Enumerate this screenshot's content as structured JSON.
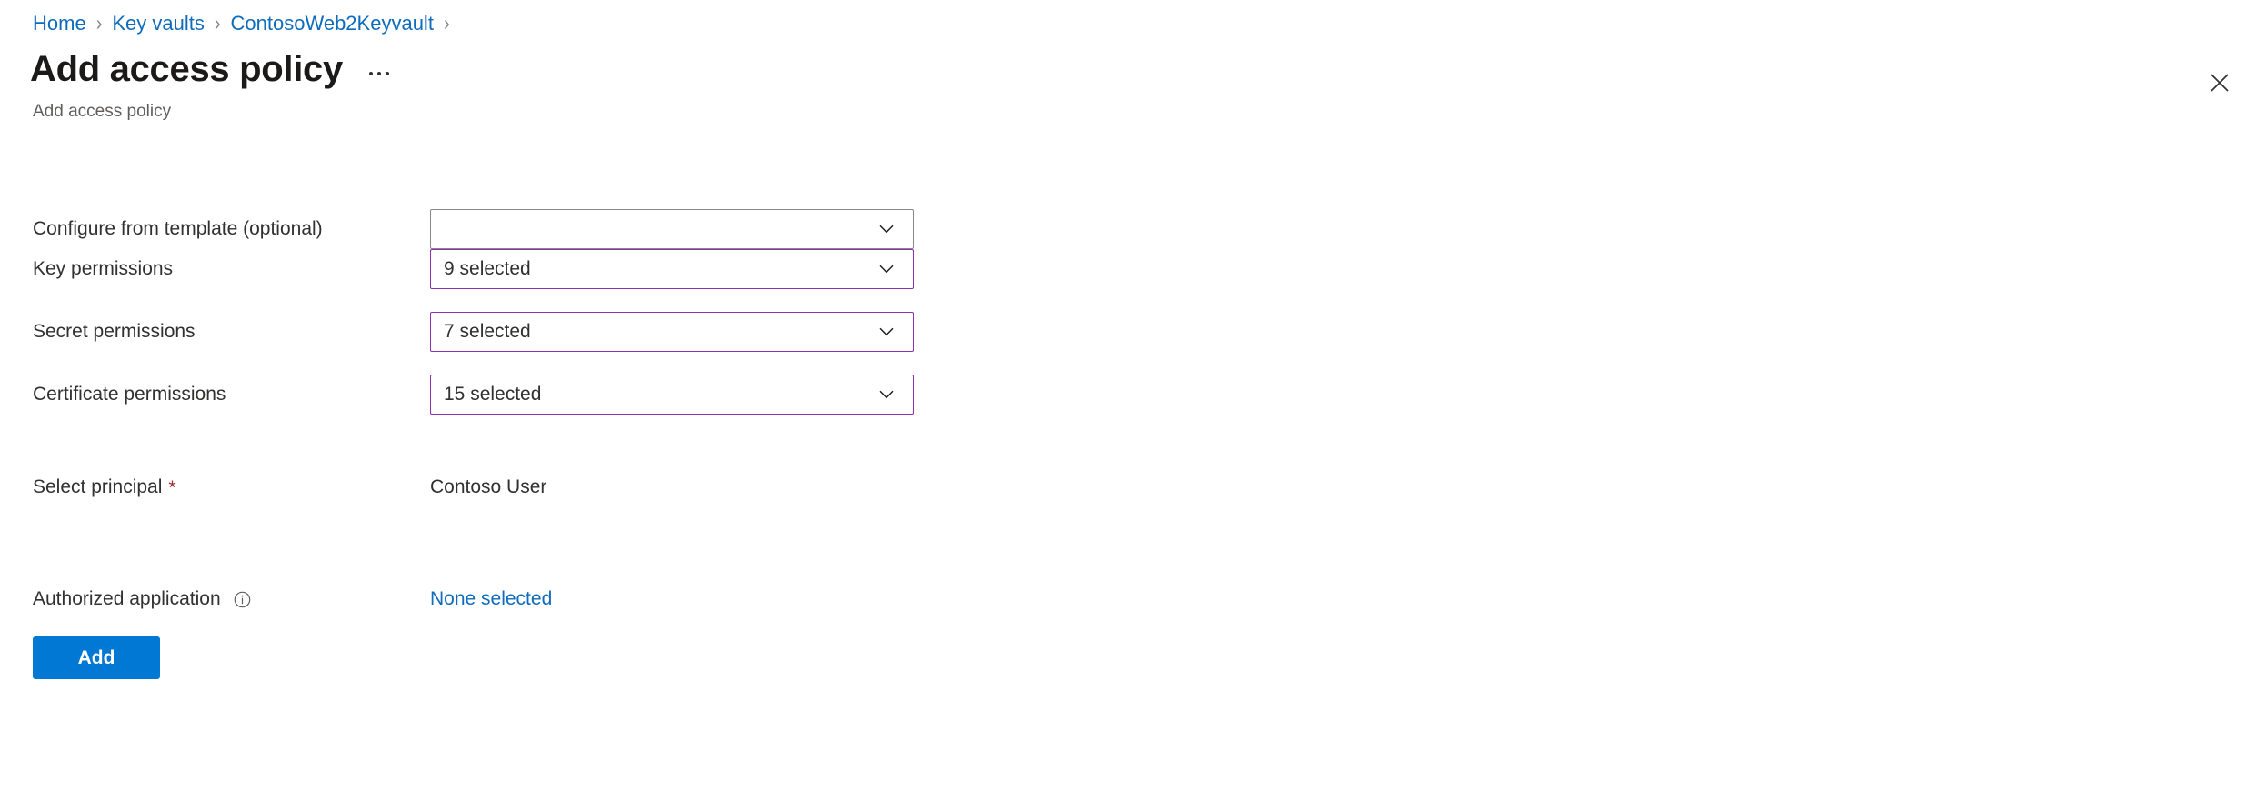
{
  "breadcrumb": {
    "items": [
      {
        "label": "Home"
      },
      {
        "label": "Key vaults"
      },
      {
        "label": "ContosoWeb2Keyvault"
      }
    ],
    "separator": "›"
  },
  "header": {
    "title": "Add access policy",
    "subtitle": "Add access policy",
    "more_actions_label": "More",
    "close_label": "Close"
  },
  "form": {
    "rows": [
      {
        "label": "Configure from template (optional)",
        "control": "dropdown",
        "value": "",
        "placeholder": "",
        "dirty": false,
        "required": false,
        "info": false
      },
      {
        "label": "Key permissions",
        "control": "dropdown",
        "value": "9 selected",
        "placeholder": "",
        "dirty": true,
        "required": false,
        "info": false
      },
      {
        "label": "Secret permissions",
        "control": "dropdown",
        "value": "7 selected",
        "placeholder": "",
        "dirty": true,
        "required": false,
        "info": false
      },
      {
        "label": "Certificate permissions",
        "control": "dropdown",
        "value": "15 selected",
        "placeholder": "",
        "dirty": true,
        "required": false,
        "info": false
      },
      {
        "label": "Select principal",
        "control": "text",
        "value": "Contoso User",
        "required": true,
        "info": false
      },
      {
        "label": "Authorized application",
        "control": "link",
        "value": "None selected",
        "required": false,
        "info": true
      }
    ],
    "required_marker": "*"
  },
  "actions": {
    "primary_label": "Add"
  },
  "colors": {
    "link": "#0f6cbd",
    "primary": "#0078d4",
    "dirty_border": "#8c2fb5",
    "neutral_border": "#8a8886",
    "required": "#a4262c",
    "subtitle": "#605e5c"
  }
}
